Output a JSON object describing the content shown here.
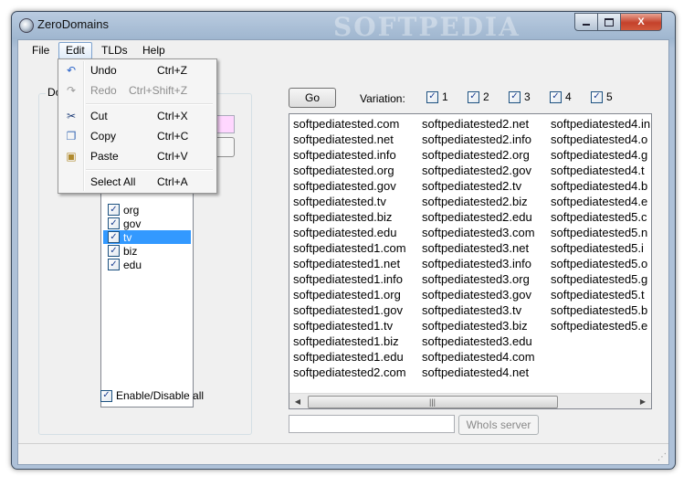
{
  "window": {
    "title": "ZeroDomains",
    "watermark": "SOFTPEDIA",
    "close_glyph": "X"
  },
  "menubar": {
    "items": [
      {
        "label": "File"
      },
      {
        "label": "Edit"
      },
      {
        "label": "TLDs"
      },
      {
        "label": "Help"
      }
    ]
  },
  "edit_menu": {
    "undo": {
      "label": "Undo",
      "shortcut": "Ctrl+Z"
    },
    "redo": {
      "label": "Redo",
      "shortcut": "Ctrl+Shift+Z"
    },
    "cut": {
      "label": "Cut",
      "shortcut": "Ctrl+X"
    },
    "copy": {
      "label": "Copy",
      "shortcut": "Ctrl+C"
    },
    "paste": {
      "label": "Paste",
      "shortcut": "Ctrl+V"
    },
    "select_all": {
      "label": "Select All",
      "shortcut": "Ctrl+A"
    }
  },
  "left_panel": {
    "group_label": "Do",
    "tlds": [
      {
        "label": "org",
        "checked": true
      },
      {
        "label": "gov",
        "checked": true
      },
      {
        "label": "tv",
        "checked": true,
        "selected": true
      },
      {
        "label": "biz",
        "checked": true
      },
      {
        "label": "edu",
        "checked": true
      }
    ],
    "enable_all_label": "Enable/Disable all"
  },
  "toolbar": {
    "go_label": "Go",
    "variation_label": "Variation:",
    "variations": [
      {
        "label": "1",
        "checked": true
      },
      {
        "label": "2",
        "checked": true
      },
      {
        "label": "3",
        "checked": true
      },
      {
        "label": "4",
        "checked": true
      },
      {
        "label": "5",
        "checked": true
      }
    ]
  },
  "results": {
    "col1": [
      "softpediatested.com",
      "softpediatested.net",
      "softpediatested.info",
      "softpediatested.org",
      "softpediatested.gov",
      "softpediatested.tv",
      "softpediatested.biz",
      "softpediatested.edu",
      "softpediatested1.com",
      "softpediatested1.net",
      "softpediatested1.info",
      "softpediatested1.org",
      "softpediatested1.gov",
      "softpediatested1.tv",
      "softpediatested1.biz",
      "softpediatested1.edu",
      "softpediatested2.com"
    ],
    "col2": [
      "softpediatested2.net",
      "softpediatested2.info",
      "softpediatested2.org",
      "softpediatested2.gov",
      "softpediatested2.tv",
      "softpediatested2.biz",
      "softpediatested2.edu",
      "softpediatested3.com",
      "softpediatested3.net",
      "softpediatested3.info",
      "softpediatested3.org",
      "softpediatested3.gov",
      "softpediatested3.tv",
      "softpediatested3.biz",
      "softpediatested3.edu",
      "softpediatested4.com",
      "softpediatested4.net"
    ],
    "col3": [
      "softpediatested4.in",
      "softpediatested4.o",
      "softpediatested4.g",
      "softpediatested4.t",
      "softpediatested4.b",
      "softpediatested4.e",
      "softpediatested5.c",
      "softpediatested5.n",
      "softpediatested5.i",
      "softpediatested5.o",
      "softpediatested5.g",
      "softpediatested5.t",
      "softpediatested5.b",
      "softpediatested5.e"
    ]
  },
  "whois": {
    "input_value": "",
    "button_label": "WhoIs server"
  },
  "colors": {
    "selection": "#3399ff",
    "pink_input": "#ffd7ff"
  }
}
